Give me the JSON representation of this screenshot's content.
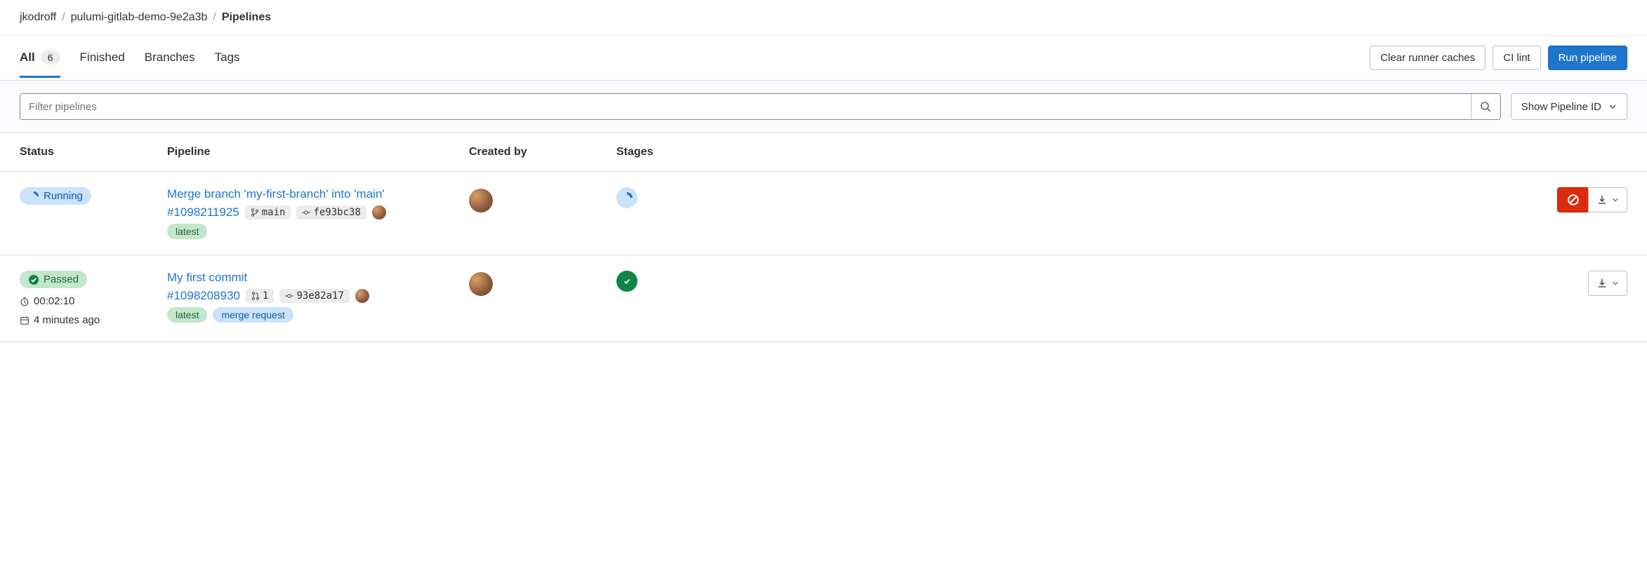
{
  "breadcrumbs": {
    "user": "jkodroff",
    "project": "pulumi-gitlab-demo-9e2a3b",
    "page": "Pipelines"
  },
  "tabs": {
    "all": {
      "label": "All",
      "count": "6"
    },
    "finished": {
      "label": "Finished"
    },
    "branches": {
      "label": "Branches"
    },
    "tags": {
      "label": "Tags"
    }
  },
  "actions": {
    "clear_caches": "Clear runner caches",
    "ci_lint": "CI lint",
    "run_pipeline": "Run pipeline"
  },
  "filter": {
    "placeholder": "Filter pipelines",
    "dropdown": "Show Pipeline ID"
  },
  "columns": {
    "status": "Status",
    "pipeline": "Pipeline",
    "created_by": "Created by",
    "stages": "Stages"
  },
  "pipelines": [
    {
      "status": {
        "label": "Running",
        "kind": "running"
      },
      "title": "Merge branch 'my-first-branch' into 'main'",
      "id": "#1098211925",
      "branch": "main",
      "commit": "fe93bc38",
      "tags": {
        "latest": "latest"
      },
      "stage": "running",
      "can_cancel": true
    },
    {
      "status": {
        "label": "Passed",
        "kind": "passed"
      },
      "duration": "00:02:10",
      "finished": "4 minutes ago",
      "title": "My first commit",
      "id": "#1098208930",
      "mr_count": "1",
      "commit": "93e82a17",
      "tags": {
        "latest": "latest",
        "merge_request": "merge request"
      },
      "stage": "passed",
      "can_cancel": false
    }
  ]
}
